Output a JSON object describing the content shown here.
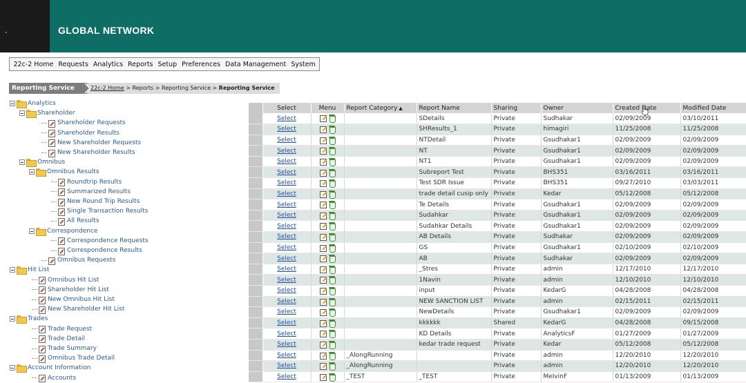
{
  "header": {
    "title": "GLOBAL NETWORK"
  },
  "menu": [
    "22c-2 Home",
    "Requests",
    "Analytics",
    "Reports",
    "Setup",
    "Preferences",
    "Data Management",
    "System"
  ],
  "breadcrumb": {
    "tab": "Reporting Service",
    "home": "22c-2 Home",
    "sep1": " > Reports > Reporting Service > ",
    "current": "Reporting Service"
  },
  "tree": [
    {
      "label": "Analytics",
      "type": "folder"
    },
    {
      "label": "Shareholder",
      "type": "folder"
    },
    {
      "label": "Shareholder Requests",
      "type": "doc"
    },
    {
      "label": "Shareholder Results",
      "type": "doc"
    },
    {
      "label": "New Shareholder Requests",
      "type": "doc"
    },
    {
      "label": "New Shareholder Results",
      "type": "doc"
    },
    {
      "label": "Omnibus",
      "type": "folder"
    },
    {
      "label": "Omnibus Results",
      "type": "folder"
    },
    {
      "label": "Roundtrip Results",
      "type": "doc"
    },
    {
      "label": "Summarized Results",
      "type": "doc"
    },
    {
      "label": "New Round Trip Results",
      "type": "doc"
    },
    {
      "label": "Single Transaction Results",
      "type": "doc"
    },
    {
      "label": "All Results",
      "type": "doc"
    },
    {
      "label": "Correspondence",
      "type": "folder"
    },
    {
      "label": "Correspondence Requests",
      "type": "doc"
    },
    {
      "label": "Correspondence Results",
      "type": "doc"
    },
    {
      "label": "Omnibus Requests",
      "type": "doc"
    },
    {
      "label": "Hit List",
      "type": "folder"
    },
    {
      "label": "Omnibus Hit List",
      "type": "doc"
    },
    {
      "label": "Shareholder Hit List",
      "type": "doc"
    },
    {
      "label": "New Omnibus Hit List",
      "type": "doc"
    },
    {
      "label": "New Shareholder Hit List",
      "type": "doc"
    },
    {
      "label": "Trades",
      "type": "folder"
    },
    {
      "label": "Trade Request",
      "type": "doc"
    },
    {
      "label": "Trade Detail",
      "type": "doc"
    },
    {
      "label": "Trade Summary",
      "type": "doc"
    },
    {
      "label": "Omnibus Trade Detail",
      "type": "doc"
    },
    {
      "label": "Account Information",
      "type": "folder"
    },
    {
      "label": "Accounts",
      "type": "doc"
    }
  ],
  "grid": {
    "columns": [
      "Select",
      "Menu",
      "Report Category",
      "Report Name",
      "Sharing",
      "Owner",
      "Created Date",
      "Modified Date"
    ],
    "sorted_column": "Report Category",
    "select_label": "Select",
    "rows": [
      [
        "",
        "SDetails",
        "Private",
        "Sudhakar",
        "02/09/2009",
        "03/10/2011"
      ],
      [
        "",
        "SHResults_1",
        "Private",
        "himagiri",
        "11/25/2008",
        "11/25/2008"
      ],
      [
        "",
        "NTDetail",
        "Private",
        "Gsudhakar1",
        "02/09/2009",
        "02/09/2009"
      ],
      [
        "",
        "NT",
        "Private",
        "Gsudhakar1",
        "02/09/2009",
        "02/09/2009"
      ],
      [
        "",
        "NT1",
        "Private",
        "Gsudhakar1",
        "02/09/2009",
        "02/09/2009"
      ],
      [
        "",
        "Subreport Test",
        "Private",
        "BHS351",
        "03/16/2011",
        "03/16/2011"
      ],
      [
        "",
        "Test SDR Issue",
        "Private",
        "BHS351",
        "09/27/2010",
        "03/03/2011"
      ],
      [
        "",
        "trade detail cusip only",
        "Private",
        "Kedar",
        "05/12/2008",
        "05/12/2008"
      ],
      [
        "",
        "Te Details",
        "Private",
        "Gsudhakar1",
        "02/09/2009",
        "02/09/2009"
      ],
      [
        "",
        "Sudahkar",
        "Private",
        "Gsudhakar1",
        "02/09/2009",
        "02/09/2009"
      ],
      [
        "",
        "Sudahkar Details",
        "Private",
        "Gsudhakar1",
        "02/09/2009",
        "02/09/2009"
      ],
      [
        "",
        "AB Details",
        "Private",
        "Sudhakar",
        "02/09/2009",
        "02/09/2009"
      ],
      [
        "",
        "GS",
        "Private",
        "Gsudhakar1",
        "02/10/2009",
        "02/10/2009"
      ],
      [
        "",
        "AB",
        "Private",
        "Sudhakar",
        "02/09/2009",
        "02/09/2009"
      ],
      [
        "",
        "_Stres",
        "Private",
        "admin",
        "12/17/2010",
        "12/17/2010"
      ],
      [
        "",
        "1Navin",
        "Private",
        "admin",
        "12/10/2010",
        "12/10/2010"
      ],
      [
        "",
        "input",
        "Private",
        "KedarG",
        "04/28/2008",
        "04/28/2008"
      ],
      [
        "",
        "NEW SANCTION LIST",
        "Private",
        "admin",
        "02/15/2011",
        "02/15/2011"
      ],
      [
        "",
        "NewDetails",
        "Private",
        "Gsudhakar1",
        "02/09/2009",
        "02/09/2009"
      ],
      [
        "",
        "kkkkkk",
        "Shared",
        "KedarG",
        "04/28/2008",
        "09/15/2008"
      ],
      [
        "",
        "KD Details",
        "Private",
        "AnalyticsF",
        "01/27/2009",
        "01/27/2009"
      ],
      [
        "",
        "kedar trade request",
        "Private",
        "Kedar",
        "05/12/2008",
        "05/12/2008"
      ],
      [
        "_AlongRunning",
        "",
        "Private",
        "admin",
        "12/20/2010",
        "12/20/2010"
      ],
      [
        "_AlongRunning",
        "",
        "Private",
        "admin",
        "12/20/2010",
        "12/20/2010"
      ],
      [
        "_TEST",
        "_TEST",
        "Private",
        "MelvinF",
        "01/13/2009",
        "01/13/2009"
      ]
    ]
  }
}
